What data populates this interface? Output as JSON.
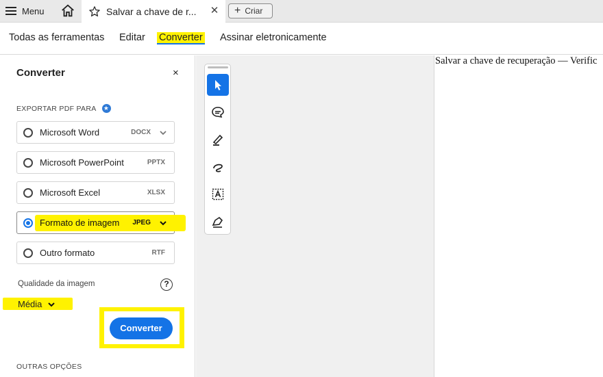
{
  "topbar": {
    "menu_label": "Menu",
    "tab_title": "Salvar a chave de r...",
    "create_label": "Criar",
    "icons": [
      "hamburger-icon",
      "home-icon",
      "star-icon",
      "close-icon",
      "plus-icon"
    ]
  },
  "nav": {
    "items": [
      "Todas as ferramentas",
      "Editar",
      "Converter",
      "Assinar eletronicamente"
    ],
    "active": "Converter"
  },
  "panel": {
    "title": "Converter",
    "close_glyph": "×",
    "export_label": "EXPORTAR PDF PARA",
    "options": [
      {
        "label": "Microsoft Word",
        "ext": "DOCX",
        "has_caret": true,
        "selected": false
      },
      {
        "label": "Microsoft PowerPoint",
        "ext": "PPTX",
        "has_caret": false,
        "selected": false
      },
      {
        "label": "Microsoft Excel",
        "ext": "XLSX",
        "has_caret": false,
        "selected": false
      },
      {
        "label": "Formato de imagem",
        "ext": "JPEG",
        "has_caret": true,
        "selected": true
      },
      {
        "label": "Outro formato",
        "ext": "RTF",
        "has_caret": false,
        "selected": false
      }
    ],
    "quality_label": "Qualidade da imagem",
    "quality_value": "Média",
    "help_glyph": "?",
    "convert_button": "Converter",
    "more_options": "OUTRAS OPÇÕES"
  },
  "toolbar": {
    "tools": [
      "select-tool",
      "comment-tool",
      "highlight-tool",
      "draw-tool",
      "text-select-tool",
      "sign-tool"
    ],
    "active": "select-tool"
  },
  "document": {
    "text": "Salvar a chave de recuperação — Verific"
  },
  "colors": {
    "accent": "#1473e6",
    "highlight": "#fff200"
  }
}
